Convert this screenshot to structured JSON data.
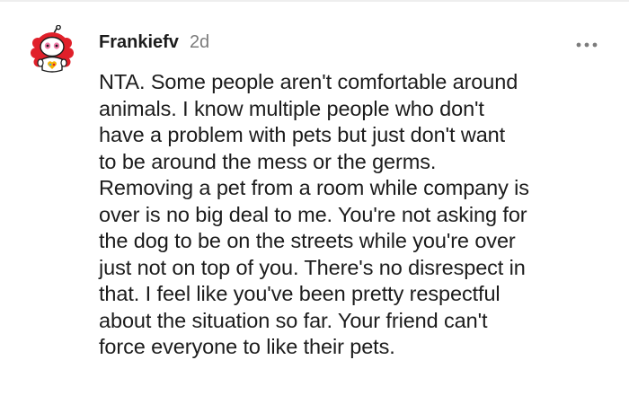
{
  "comment": {
    "username": "Frankiefv",
    "timestamp": "2d",
    "more_icon": "more-options-icon",
    "avatar_icon": "snoo-avatar-icon",
    "body_lines": [
      "NTA. Some people aren't comfortable around",
      "animals. I know multiple people who don't",
      "have a problem with pets but just don't want",
      "to be around the mess or the germs.",
      "Removing a pet from a room while company is",
      "over is no big deal to me. You're not asking for",
      "the dog to be on the streets while you're over",
      "just not on top of you. There's no disrespect in",
      "that. I feel like you've been pretty respectful",
      "about the situation so far. Your friend can't",
      "force everyone to like their pets."
    ]
  },
  "colors": {
    "text": "#1c1c1c",
    "meta": "#7c7c7c",
    "avatar_red": "#e0202a",
    "avatar_pink": "#f07aa8",
    "background": "#ffffff"
  }
}
